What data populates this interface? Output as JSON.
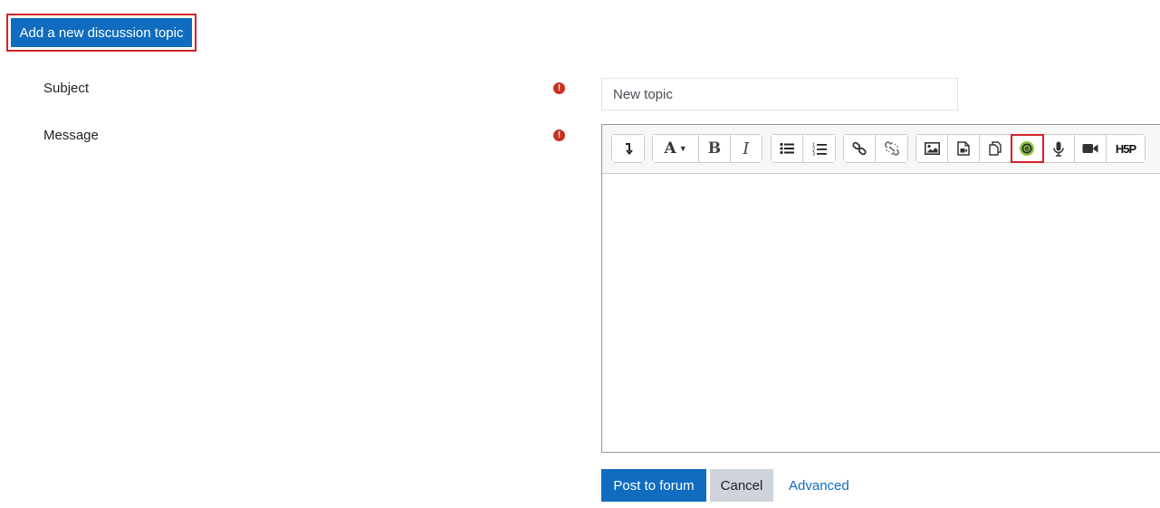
{
  "header": {
    "add_topic_label": "Add a new discussion topic"
  },
  "form": {
    "subject_label": "Subject",
    "subject_value": "New topic",
    "message_label": "Message",
    "required_mark": "!"
  },
  "toolbar": {
    "font_glyph": "A",
    "bold_glyph": "B",
    "italic_glyph": "I",
    "h5p_label": "H5P"
  },
  "actions": {
    "post_label": "Post to forum",
    "cancel_label": "Cancel",
    "advanced_label": "Advanced"
  },
  "colors": {
    "primary": "#0f6cbf",
    "highlight": "#d3222a",
    "required": "#ca3120",
    "secondary": "#ced4da"
  }
}
